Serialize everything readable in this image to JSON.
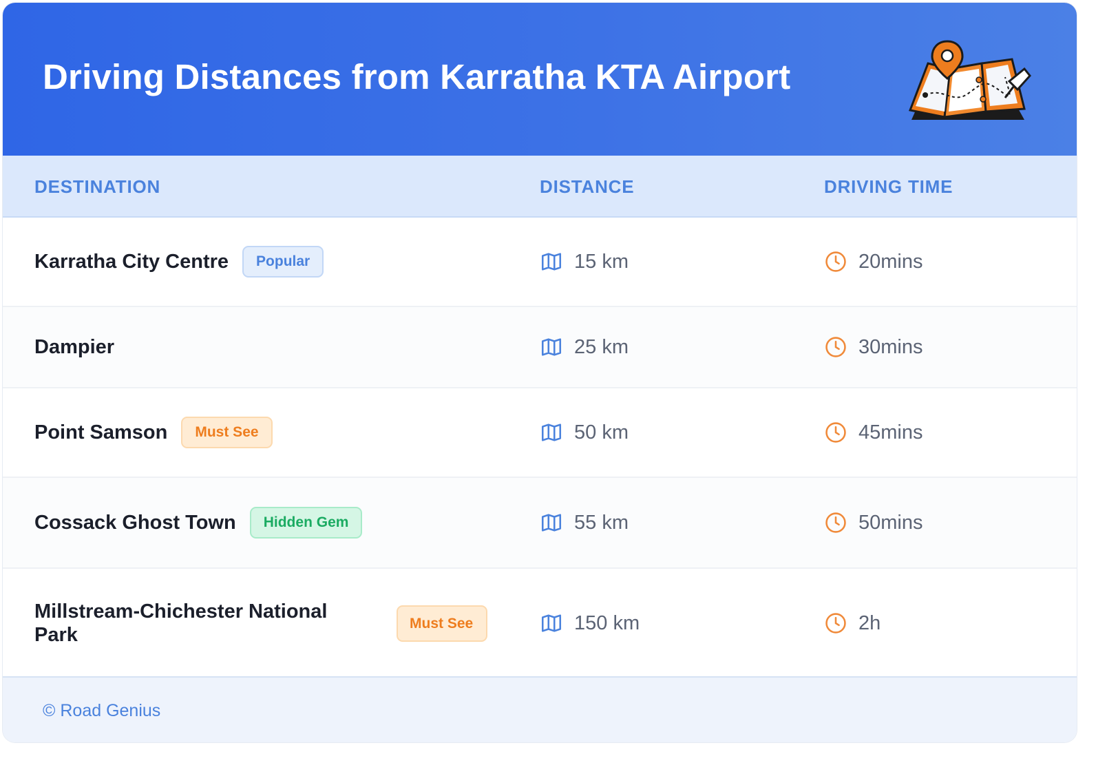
{
  "header": {
    "title": "Driving Distances from Karratha KTA Airport",
    "illustration": "map-with-location-pin-icon"
  },
  "table": {
    "columns": [
      "DESTINATION",
      "DISTANCE",
      "DRIVING TIME"
    ],
    "rows": [
      {
        "destination": "Karratha City Centre",
        "badge": "Popular",
        "distance": "15 km",
        "time": "20mins"
      },
      {
        "destination": "Dampier",
        "badge": "",
        "distance": "25 km",
        "time": "30mins"
      },
      {
        "destination": "Point Samson",
        "badge": "Must See",
        "distance": "50 km",
        "time": "45mins"
      },
      {
        "destination": "Cossack Ghost Town",
        "badge": "Hidden Gem",
        "distance": "55 km",
        "time": "50mins"
      },
      {
        "destination": "Millstream-Chichester National Park",
        "badge": "Must See",
        "distance": "150 km",
        "time": "2h"
      }
    ],
    "distance_icon": "map-icon",
    "time_icon": "clock-icon"
  },
  "footer": {
    "text": "© Road Genius"
  },
  "colors": {
    "header_gradient_start": "#2f66e6",
    "header_gradient_end": "#4b80e6",
    "accent_blue": "#4a82dd",
    "orange": "#ee7d1e",
    "green": "#1bab62"
  }
}
